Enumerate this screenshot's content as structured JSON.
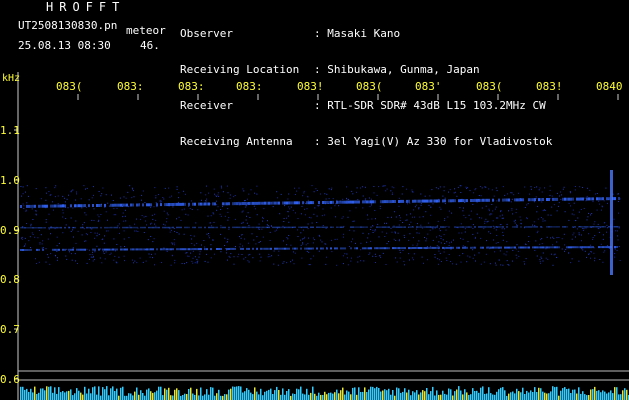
{
  "header": {
    "title": "HROFFT",
    "filename": "UT2508130830.pn",
    "datetime": "25.08.13 08:30",
    "meteor_label": "meteor",
    "meteor_count": "46."
  },
  "info": [
    {
      "label": "Observer",
      "value": ": Masaki Kano"
    },
    {
      "label": "Receiving Location",
      "value": ": Shibukawa, Gunma, Japan"
    },
    {
      "label": "Receiver",
      "value": ": RTL-SDR SDR# 43dB L15 103.2MHz CW"
    },
    {
      "label": "Receiving Antenna",
      "value": ": 3el Yagi(V) Az 330 for Vladivostok"
    }
  ],
  "axis": {
    "y_unit": "kHz",
    "y_ticks": [
      "1.1",
      "1.0",
      "0.9",
      "0.8",
      "0.7",
      "0.6"
    ],
    "x_ticks": [
      "083(",
      "083:",
      "083:",
      "083:",
      "083!",
      "083(",
      "083'",
      "083(",
      "083!",
      "0840"
    ]
  },
  "colors": {
    "background": "#000000",
    "text": "#ffffff",
    "axis_labels": "#ffff33",
    "signal": "#3366ff",
    "noise_bars": "#33ccff"
  }
}
